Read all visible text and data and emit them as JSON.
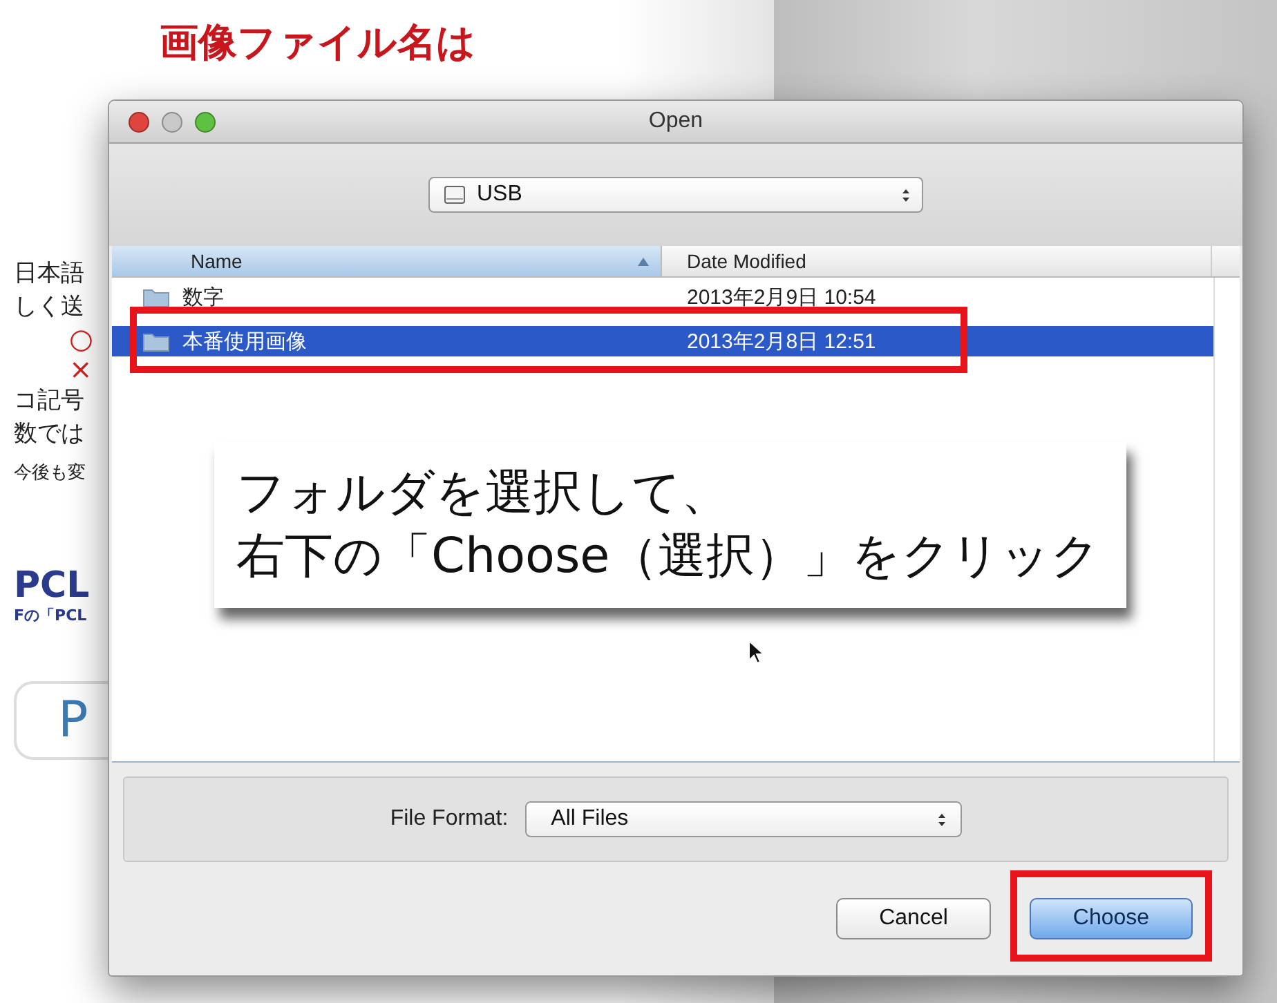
{
  "background_page": {
    "heading_lines": [
      "画像ファイル名は"
    ],
    "side_texts": [
      {
        "kind": "text",
        "text": "日本語"
      },
      {
        "kind": "text",
        "text": "しく送"
      },
      {
        "kind": "mark",
        "text": "○"
      },
      {
        "kind": "mark",
        "text": "×"
      },
      {
        "kind": "text",
        "text": "コ記号"
      },
      {
        "kind": "text",
        "text": "数では"
      },
      {
        "kind": "small",
        "text": "今後も変"
      },
      {
        "kind": "title",
        "text": "PCL"
      },
      {
        "kind": "subtitle",
        "text": "Fの「PCL"
      },
      {
        "kind": "button",
        "text": "P"
      }
    ]
  },
  "dialog": {
    "title": "Open",
    "location": "USB",
    "columns": [
      {
        "label": "Name",
        "sorted": true
      },
      {
        "label": "Date Modified",
        "sorted": false
      }
    ],
    "rows": [
      {
        "name": "数字",
        "date": "2013年2月9日 10:54",
        "selected": false,
        "highlighted": false
      },
      {
        "name": "本番使用画像",
        "date": "2013年2月8日 12:51",
        "selected": true,
        "highlighted": true
      }
    ],
    "file_format": {
      "label": "File Format:",
      "value": "All Files"
    },
    "buttons": [
      {
        "label": "Cancel",
        "default": false,
        "highlighted": false
      },
      {
        "label": "Choose",
        "default": true,
        "highlighted": true
      }
    ]
  },
  "callout": {
    "lines": [
      "フォルダを選択して、",
      "右下の「Choose（選択）」をクリック"
    ]
  }
}
